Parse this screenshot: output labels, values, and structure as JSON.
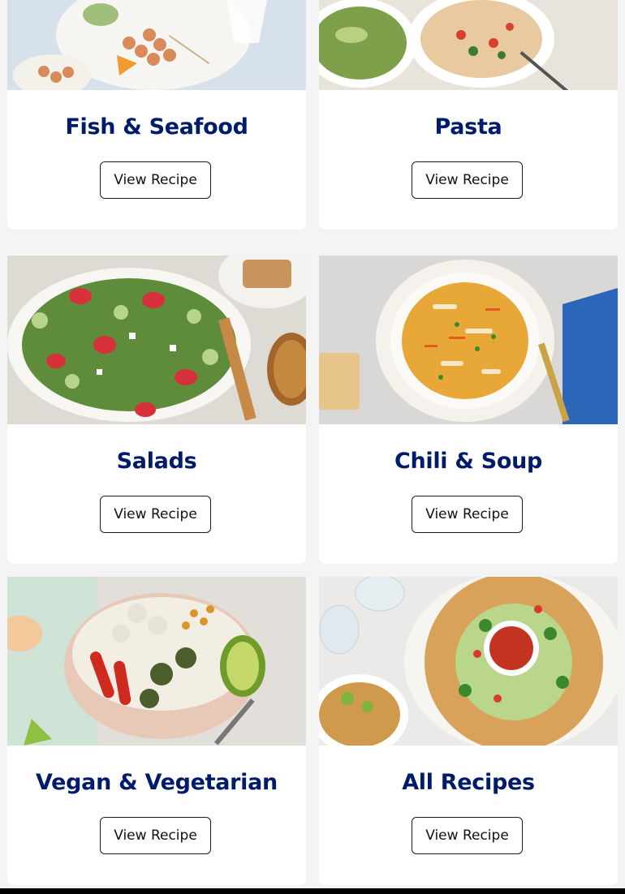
{
  "cards": [
    {
      "title": "Fish & Seafood",
      "button": "View Recipe",
      "image": "grilled-shrimp-skewers-photo"
    },
    {
      "title": "Pasta",
      "button": "View Recipe",
      "image": "pasta-and-salad-photo"
    },
    {
      "title": "Salads",
      "button": "View Recipe",
      "image": "strawberry-spinach-salad-photo"
    },
    {
      "title": "Chili & Soup",
      "button": "View Recipe",
      "image": "chicken-soup-bowl-photo"
    },
    {
      "title": "Vegan & Vegetarian",
      "button": "View Recipe",
      "image": "vegetable-grain-bowl-photo"
    },
    {
      "title": "All Recipes",
      "button": "View Recipe",
      "image": "taco-ring-platter-photo"
    }
  ],
  "colors": {
    "title": "#001b6b",
    "background": "#f4f4f4",
    "card": "#ffffff"
  }
}
